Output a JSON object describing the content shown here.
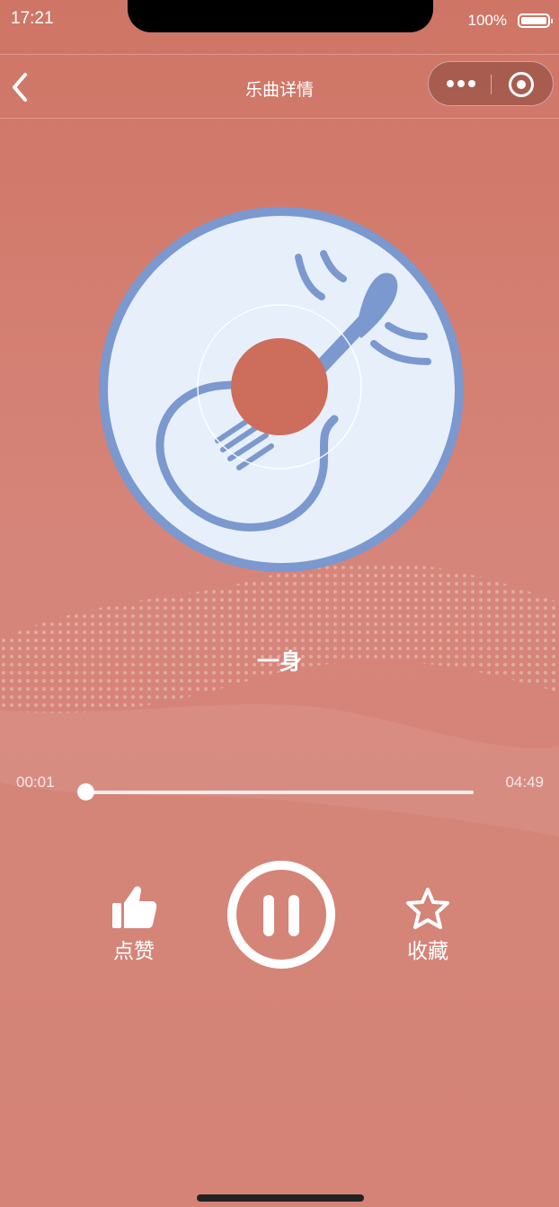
{
  "status_bar": {
    "time": "17:21",
    "battery": "100%"
  },
  "navbar": {
    "title": "乐曲详情"
  },
  "song": {
    "title": "一身"
  },
  "progress": {
    "current": "00:01",
    "total": "04:49",
    "fraction": 0.003
  },
  "controls": {
    "like_label": "点赞",
    "favorite_label": "收藏",
    "state": "playing"
  },
  "colors": {
    "background": "#d4806f",
    "disc_fill": "#e7effb",
    "disc_accent": "#7b98cf",
    "center": "#cd6d5b"
  },
  "icons": {
    "disc": "guitar-disc-icon",
    "like": "thumbs-up-icon",
    "favorite": "star-icon",
    "play_pause": "pause-icon",
    "back": "chevron-left-icon",
    "more": "more-dots-icon",
    "close": "target-close-icon"
  }
}
